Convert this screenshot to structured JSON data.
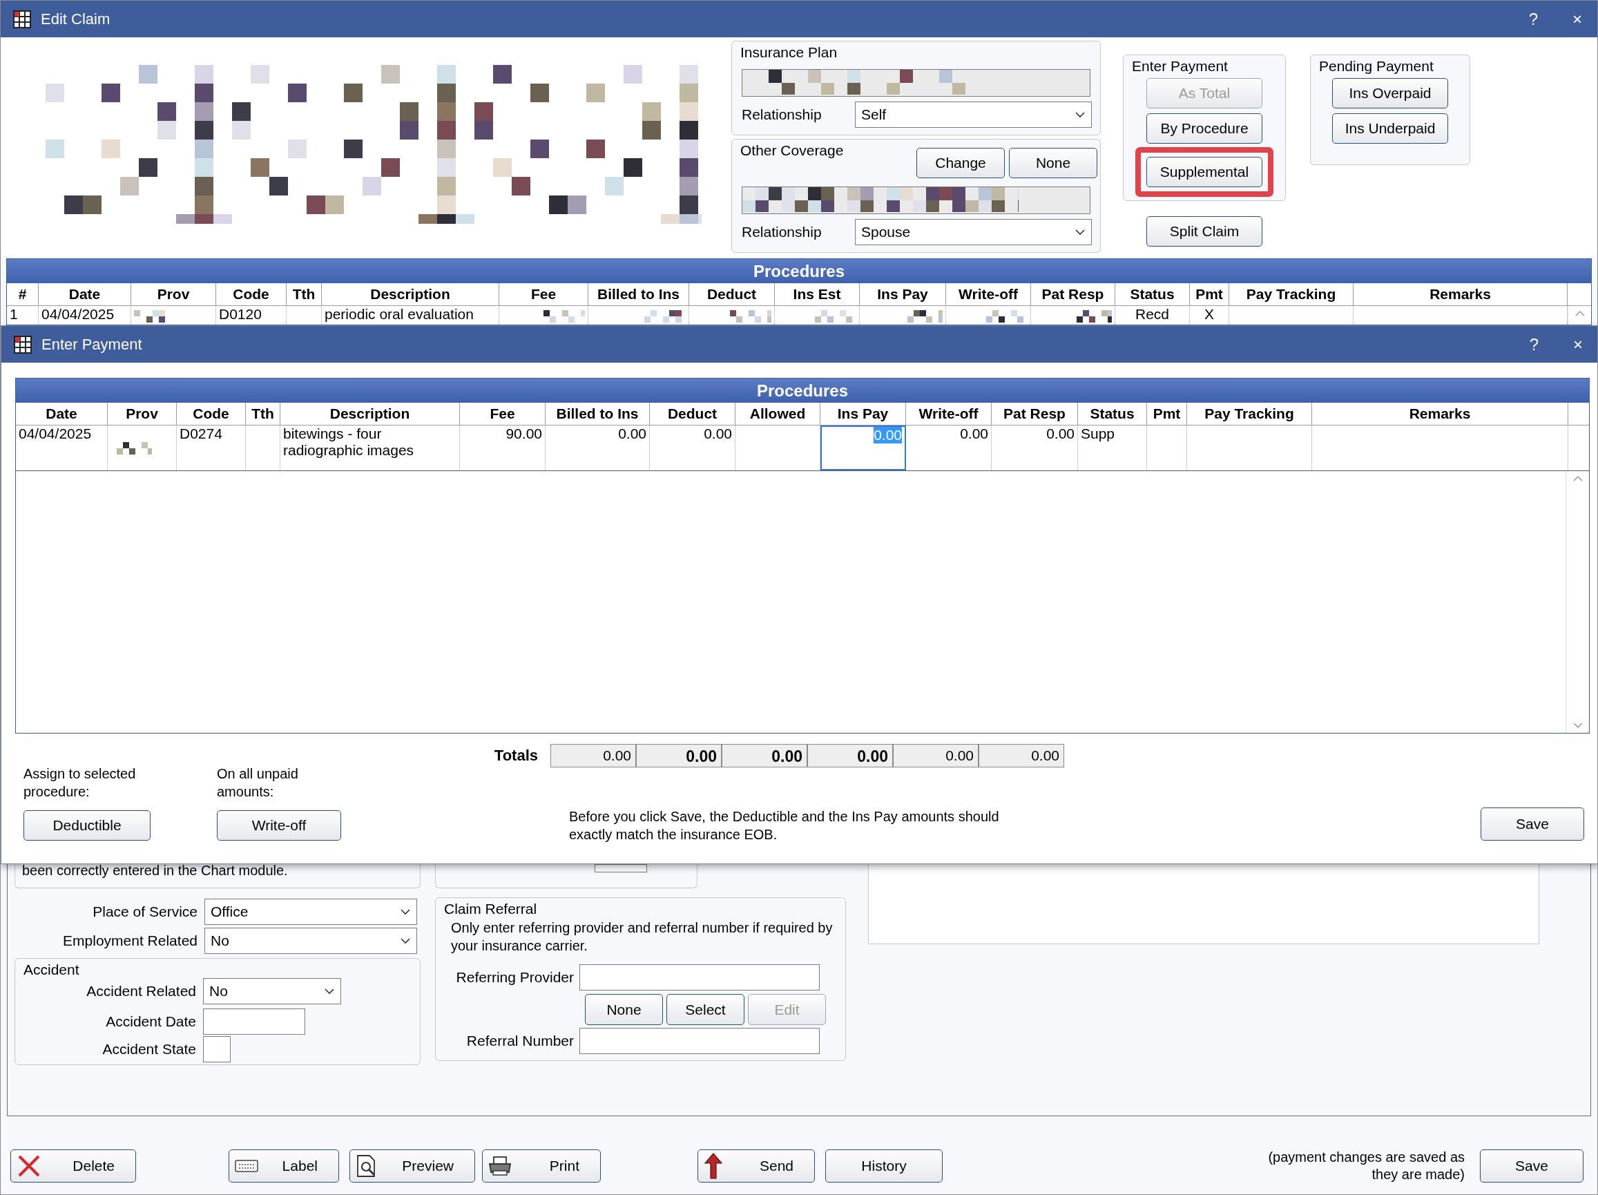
{
  "edit_claim": {
    "title": "Edit Claim",
    "help": "?",
    "close": "×",
    "insurance_plan": {
      "title": "Insurance Plan",
      "relationship_label": "Relationship",
      "relationship": "Self"
    },
    "other_coverage": {
      "title": "Other Coverage",
      "buttons": [
        "Change",
        "None"
      ],
      "relationship_label": "Relationship",
      "relationship": "Spouse"
    },
    "enter_payment": {
      "title": "Enter Payment",
      "buttons": [
        {
          "label": "As Total",
          "disabled": true,
          "highlighted": false
        },
        {
          "label": "By Procedure",
          "disabled": false,
          "highlighted": false
        },
        {
          "label": "Supplemental",
          "disabled": false,
          "highlighted": true
        }
      ]
    },
    "split_claim": "Split Claim",
    "pending_payment": {
      "title": "Pending Payment",
      "buttons": [
        "Ins Overpaid",
        "Ins Underpaid"
      ]
    },
    "procedures": {
      "title": "Procedures",
      "columns": [
        {
          "label": "#",
          "kind": "text"
        },
        {
          "label": "Date",
          "kind": "text"
        },
        {
          "label": "Prov",
          "kind": "text"
        },
        {
          "label": "Code",
          "kind": "text"
        },
        {
          "label": "Tth",
          "kind": "text"
        },
        {
          "label": "Description",
          "kind": "text"
        },
        {
          "label": "Fee",
          "kind": "number"
        },
        {
          "label": "Billed to Ins",
          "kind": "number"
        },
        {
          "label": "Deduct",
          "kind": "number"
        },
        {
          "label": "Ins Est",
          "kind": "number"
        },
        {
          "label": "Ins Pay",
          "kind": "number"
        },
        {
          "label": "Write-off",
          "kind": "number"
        },
        {
          "label": "Pat Resp",
          "kind": "number"
        },
        {
          "label": "Status",
          "kind": "center"
        },
        {
          "label": "Pmt",
          "kind": "center"
        },
        {
          "label": "Pay Tracking",
          "kind": "text"
        },
        {
          "label": "Remarks",
          "kind": "text"
        }
      ],
      "rows": [
        {
          "cells": [
            {
              "kind": "text",
              "text": "1"
            },
            {
              "kind": "text",
              "text": "04/04/2025"
            },
            {
              "kind": "redacted"
            },
            {
              "kind": "text",
              "text": "D0120"
            },
            {
              "kind": "blank"
            },
            {
              "kind": "text",
              "text": "periodic oral evaluation"
            },
            {
              "kind": "redacted"
            },
            {
              "kind": "redacted"
            },
            {
              "kind": "redacted"
            },
            {
              "kind": "redacted"
            },
            {
              "kind": "redacted"
            },
            {
              "kind": "redacted"
            },
            {
              "kind": "redacted"
            },
            {
              "kind": "text",
              "text": "Recd"
            },
            {
              "kind": "text",
              "text": "X"
            },
            {
              "kind": "blank"
            },
            {
              "kind": "blank"
            }
          ]
        }
      ]
    },
    "partial_note": "been correctly entered in the Chart module.",
    "place_of_service": {
      "label": "Place of Service",
      "value": "Office"
    },
    "employment_related": {
      "label": "Employment Related",
      "value": "No"
    },
    "accident": {
      "title": "Accident",
      "related_label": "Accident Related",
      "related": "No",
      "date_label": "Accident Date",
      "state_label": "Accident State"
    },
    "claim_referral": {
      "title": "Claim Referral",
      "note": "Only enter referring provider and referral number if required by your insurance carrier.",
      "referring_provider_label": "Referring Provider",
      "buttons": [
        {
          "label": "None",
          "disabled": false
        },
        {
          "label": "Select",
          "disabled": false
        },
        {
          "label": "Edit",
          "disabled": true
        }
      ],
      "referral_number_label": "Referral Number"
    },
    "toolbar": [
      {
        "label": "Delete",
        "kind": "delete"
      },
      {
        "label": "Label",
        "kind": "label"
      },
      {
        "label": "Preview",
        "kind": "preview"
      },
      {
        "label": "Print",
        "kind": "print"
      },
      {
        "label": "Send",
        "kind": "send"
      },
      {
        "label": "History",
        "kind": "plain"
      }
    ],
    "save_note": "(payment changes are saved as they are made)",
    "save_button": "Save"
  },
  "enter_payment_window": {
    "title": "Enter Payment",
    "help": "?",
    "close": "×",
    "procedures": {
      "title": "Procedures",
      "columns": [
        {
          "label": "Date",
          "kind": "text"
        },
        {
          "label": "Prov",
          "kind": "text"
        },
        {
          "label": "Code",
          "kind": "text"
        },
        {
          "label": "Tth",
          "kind": "text"
        },
        {
          "label": "Description",
          "kind": "text"
        },
        {
          "label": "Fee",
          "kind": "number"
        },
        {
          "label": "Billed to Ins",
          "kind": "number"
        },
        {
          "label": "Deduct",
          "kind": "number"
        },
        {
          "label": "Allowed",
          "kind": "number"
        },
        {
          "label": "Ins Pay",
          "kind": "number"
        },
        {
          "label": "Write-off",
          "kind": "number"
        },
        {
          "label": "Pat Resp",
          "kind": "number"
        },
        {
          "label": "Status",
          "kind": "text"
        },
        {
          "label": "Pmt",
          "kind": "center"
        },
        {
          "label": "Pay Tracking",
          "kind": "text"
        },
        {
          "label": "Remarks",
          "kind": "text"
        }
      ],
      "rows": [
        {
          "cells": [
            {
              "kind": "text",
              "text": "04/04/2025"
            },
            {
              "kind": "redacted"
            },
            {
              "kind": "text",
              "text": "D0274"
            },
            {
              "kind": "blank"
            },
            {
              "kind": "text",
              "text": "bitewings - four radiographic images"
            },
            {
              "kind": "text",
              "text": "90.00"
            },
            {
              "kind": "text",
              "text": "0.00"
            },
            {
              "kind": "text",
              "text": "0.00"
            },
            {
              "kind": "blank"
            },
            {
              "kind": "editing",
              "text": "0.00"
            },
            {
              "kind": "text",
              "text": "0.00"
            },
            {
              "kind": "text",
              "text": "0.00"
            },
            {
              "kind": "text",
              "text": "Supp"
            },
            {
              "kind": "blank"
            },
            {
              "kind": "blank"
            },
            {
              "kind": "blank"
            }
          ]
        }
      ]
    },
    "totals_label": "Totals",
    "totals": [
      {
        "value": "0.00",
        "bold": false
      },
      {
        "value": "0.00",
        "bold": true
      },
      {
        "value": "0.00",
        "bold": true
      },
      {
        "value": "0.00",
        "bold": true
      },
      {
        "value": "0.00",
        "bold": false
      },
      {
        "value": "0.00",
        "bold": false
      }
    ],
    "assign_label": "Assign to selected procedure:",
    "deductible_button": "Deductible",
    "unpaid_label": "On all unpaid amounts:",
    "writeoff_button": "Write-off",
    "note": "Before you click Save, the Deductible and the Ins Pay amounts should exactly match the insurance EOB.",
    "save_button": "Save"
  }
}
